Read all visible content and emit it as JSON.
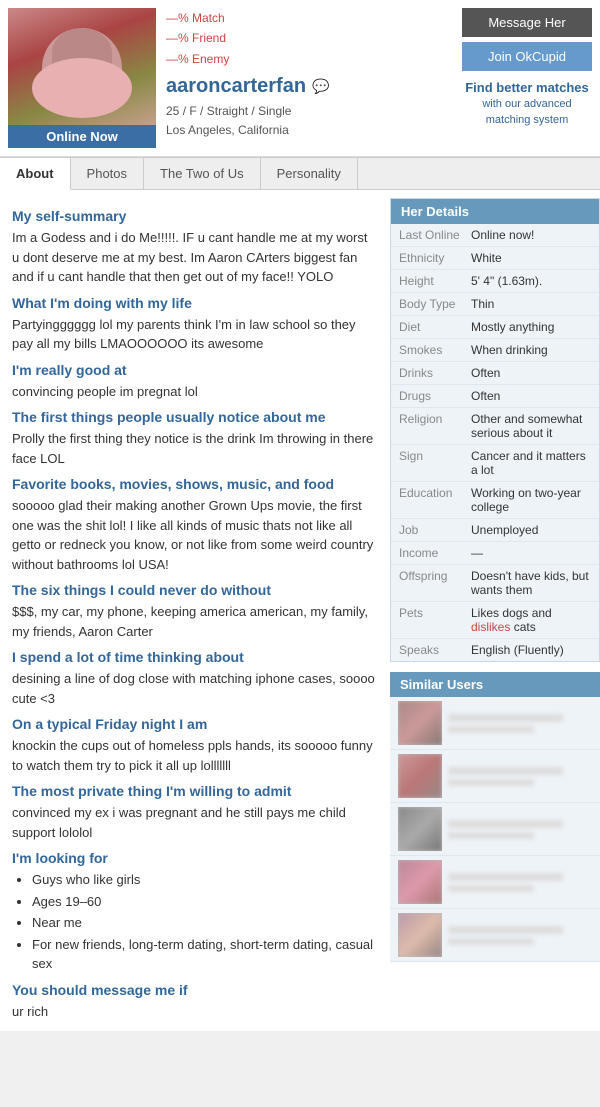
{
  "header": {
    "online_badge": "Online Now",
    "match_label": "—% Match",
    "friend_label": "—% Friend",
    "enemy_label": "—% Enemy",
    "username": "aaroncarterfan",
    "age": "25",
    "gender": "F",
    "orientation": "Straight",
    "status": "Single",
    "location": "Los Angeles, California",
    "message_btn": "Message Her",
    "join_btn": "Join OkCupid",
    "find_better_title": "Find better matches",
    "find_better_sub": "with our advanced matching system"
  },
  "tabs": [
    {
      "label": "About",
      "active": true
    },
    {
      "label": "Photos",
      "active": false
    },
    {
      "label": "The Two of Us",
      "active": false
    },
    {
      "label": "Personality",
      "active": false
    }
  ],
  "sections": [
    {
      "id": "self-summary",
      "title": "My self-summary",
      "body": "Im a Godess and i do Me!!!!!. IF u cant handle me at my worst u dont deserve me at my best. Im Aaron CArters biggest fan and if u cant handle that then get out of my face!! YOLO"
    },
    {
      "id": "doing-with-life",
      "title": "What I'm doing with my life",
      "body": "Partyingggggg lol my parents think I'm in law school so they pay all my bills LMAOOOOOO its awesome"
    },
    {
      "id": "really-good-at",
      "title": "I'm really good at",
      "body": "convincing people im pregnat lol"
    },
    {
      "id": "first-notice",
      "title": "The first things people usually notice about me",
      "body": "Prolly the first thing they notice is the drink Im throwing in there face LOL"
    },
    {
      "id": "favorite-things",
      "title": "Favorite books, movies, shows, music, and food",
      "body": "sooooo glad their making another Grown Ups movie, the first one was the shit lol! I like all kinds of music thats not like all getto or redneck you know, or not like from some weird country without bathrooms lol USA!"
    },
    {
      "id": "six-things",
      "title": "The six things I could never do without",
      "body": "$$$, my car, my phone, keeping america american, my family, my friends, Aaron Carter"
    },
    {
      "id": "thinking-about",
      "title": "I spend a lot of time thinking about",
      "body": "desining a line of dog close with matching iphone cases, soooo cute <3"
    },
    {
      "id": "friday-night",
      "title": "On a typical Friday night I am",
      "body": "knockin the cups out of homeless ppls hands, its sooooo funny to watch them try to pick it all up lolllllll"
    },
    {
      "id": "private-thing",
      "title": "The most private thing I'm willing to admit",
      "body": "convinced my ex i was pregnant and he still pays me child support lololol"
    },
    {
      "id": "looking-for",
      "title": "I'm looking for",
      "list": [
        "Guys who like girls",
        "Ages 19–60",
        "Near me",
        "For new friends, long-term dating, short-term dating, casual sex"
      ]
    },
    {
      "id": "message-me",
      "title": "You should message me if",
      "body": "ur rich"
    }
  ],
  "details": {
    "header": "Her Details",
    "rows": [
      {
        "label": "Last Online",
        "value": "Online now!"
      },
      {
        "label": "Ethnicity",
        "value": "White"
      },
      {
        "label": "Height",
        "value": "5' 4\" (1.63m)."
      },
      {
        "label": "Body Type",
        "value": "Thin"
      },
      {
        "label": "Diet",
        "value": "Mostly anything"
      },
      {
        "label": "Smokes",
        "value": "When drinking"
      },
      {
        "label": "Drinks",
        "value": "Often"
      },
      {
        "label": "Drugs",
        "value": "Often"
      },
      {
        "label": "Religion",
        "value": "Other and somewhat serious about it"
      },
      {
        "label": "Sign",
        "value": "Cancer and it matters a lot"
      },
      {
        "label": "Education",
        "value": "Working on two-year college"
      },
      {
        "label": "Job",
        "value": "Unemployed"
      },
      {
        "label": "Income",
        "value": "—"
      },
      {
        "label": "Offspring",
        "value": "Doesn't have kids, but wants them"
      },
      {
        "label": "Pets",
        "value": "Likes dogs and dislikes cats",
        "dislike_word": "dislikes"
      },
      {
        "label": "Speaks",
        "value": "English (Fluently)"
      }
    ]
  },
  "similar_users": {
    "header": "Similar Users",
    "count": 5
  }
}
